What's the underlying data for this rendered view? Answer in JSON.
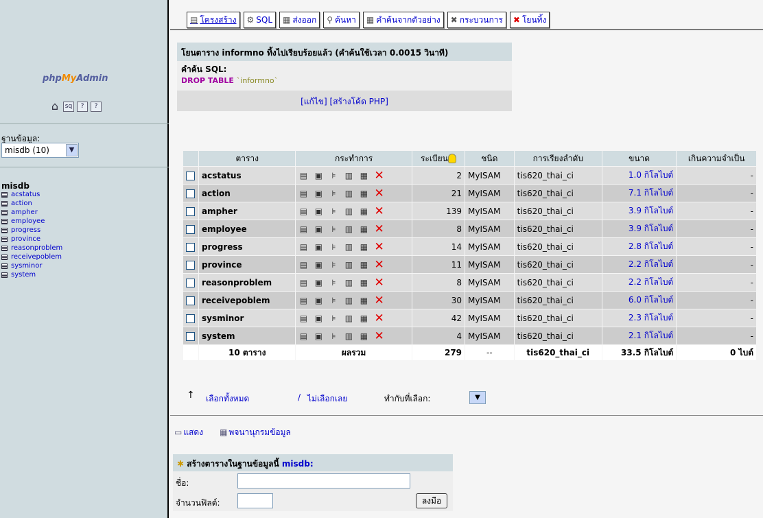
{
  "logo": {
    "part1": "php",
    "part2": "My",
    "part3": "Admin"
  },
  "sidebar": {
    "quick_icons": [
      "home-icon",
      "sql-query-icon",
      "docs-icon",
      "sql-docs-icon"
    ],
    "db_label": "ฐานข้อมูล:",
    "db_select_value": "misdb (10)",
    "db_name": "misdb",
    "tables": [
      "acstatus",
      "action",
      "ampher",
      "employee",
      "progress",
      "province",
      "reasonproblem",
      "receivepoblem",
      "sysminor",
      "system"
    ]
  },
  "tabs": [
    {
      "label": "โครงสร้าง",
      "icon": "structure-icon"
    },
    {
      "label": "SQL",
      "icon": "sql-icon"
    },
    {
      "label": "ส่งออก",
      "icon": "export-icon"
    },
    {
      "label": "ค้นหา",
      "icon": "search-icon"
    },
    {
      "label": "คำค้นจากตัวอย่าง",
      "icon": "query-icon"
    },
    {
      "label": "กระบวนการ",
      "icon": "operations-icon"
    },
    {
      "label": "โยนทิ้ง",
      "icon": "drop-icon"
    }
  ],
  "message": {
    "header": "โยนตาราง informno ทิ้งไปเรียบร้อยแล้ว (คำค้นใช้เวลา 0.0015 วินาที)",
    "sql_label": "คำค้น SQL:",
    "sql_keyword": "DROP TABLE",
    "sql_table": "`informno`",
    "edit_link": "แก้ไข",
    "php_link": "สร้างโค้ด PHP"
  },
  "table": {
    "headers": [
      "ตาราง",
      "กระทำการ",
      "ระเบียน",
      "ชนิด",
      "การเรียงลำดับ",
      "ขนาด",
      "เกินความจำเป็น"
    ],
    "rows": [
      {
        "name": "acstatus",
        "records": "2",
        "type": "MyISAM",
        "collation": "tis620_thai_ci",
        "size": "1.0 กิโลไบต์",
        "overhead": "-"
      },
      {
        "name": "action",
        "records": "21",
        "type": "MyISAM",
        "collation": "tis620_thai_ci",
        "size": "7.1 กิโลไบต์",
        "overhead": "-"
      },
      {
        "name": "ampher",
        "records": "139",
        "type": "MyISAM",
        "collation": "tis620_thai_ci",
        "size": "3.9 กิโลไบต์",
        "overhead": "-"
      },
      {
        "name": "employee",
        "records": "8",
        "type": "MyISAM",
        "collation": "tis620_thai_ci",
        "size": "3.9 กิโลไบต์",
        "overhead": "-"
      },
      {
        "name": "progress",
        "records": "14",
        "type": "MyISAM",
        "collation": "tis620_thai_ci",
        "size": "2.8 กิโลไบต์",
        "overhead": "-"
      },
      {
        "name": "province",
        "records": "11",
        "type": "MyISAM",
        "collation": "tis620_thai_ci",
        "size": "2.2 กิโลไบต์",
        "overhead": "-"
      },
      {
        "name": "reasonproblem",
        "records": "8",
        "type": "MyISAM",
        "collation": "tis620_thai_ci",
        "size": "2.2 กิโลไบต์",
        "overhead": "-"
      },
      {
        "name": "receivepoblem",
        "records": "30",
        "type": "MyISAM",
        "collation": "tis620_thai_ci",
        "size": "6.0 กิโลไบต์",
        "overhead": "-"
      },
      {
        "name": "sysminor",
        "records": "42",
        "type": "MyISAM",
        "collation": "tis620_thai_ci",
        "size": "2.3 กิโลไบต์",
        "overhead": "-"
      },
      {
        "name": "system",
        "records": "4",
        "type": "MyISAM",
        "collation": "tis620_thai_ci",
        "size": "2.1 กิโลไบต์",
        "overhead": "-"
      }
    ],
    "footer": {
      "tables": "10 ตาราง",
      "sum": "ผลรวม",
      "records": "279",
      "type": "--",
      "collation": "tis620_thai_ci",
      "size": "33.5 กิโลไบต์",
      "overhead": "0 ไบต์"
    }
  },
  "selection": {
    "check_all": "เลือกทั้งหมด",
    "separator": "/",
    "uncheck_all": "ไม่เลือกเลย",
    "with_selected": "ทำกับที่เลือก:"
  },
  "bottom_links": {
    "print": "แสดง",
    "dictionary": "พจนานุกรมข้อมูล"
  },
  "create": {
    "title": "สร้างตารางในฐานข้อมูลนี้",
    "db": "misdb:",
    "name_label": "ชื่อ:",
    "fields_label": "จำนวนฟิลด์:",
    "go": "ลงมือ"
  },
  "colors": {
    "sidebar": "#d0dce0",
    "header_row": "#d0dce0",
    "row_odd": "#dddddd",
    "row_even": "#cccccc",
    "link": "#0000cc",
    "drop": "#e00000"
  }
}
